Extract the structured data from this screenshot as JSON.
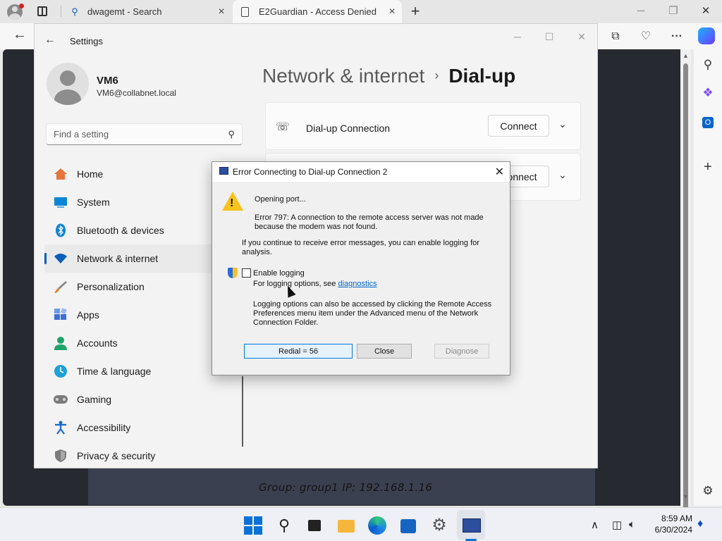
{
  "browser": {
    "tabs": [
      {
        "title": "dwagemt - Search",
        "icon": "search-icon"
      },
      {
        "title": "E2Guardian - Access Denied",
        "icon": "page-icon"
      }
    ],
    "new_tab_label": "+",
    "window_minimize": "─",
    "window_restore": "❐",
    "window_close": "✕",
    "back_label": "←",
    "toolbar_icons": [
      "collections-icon",
      "performance-icon",
      "more-icon",
      "copilot-icon"
    ],
    "more_label": "···",
    "sidebar_icons": [
      "search-icon",
      "copilot-icon",
      "outlook-icon",
      "add-icon",
      "settings-icon"
    ]
  },
  "remote": {
    "info": "Group: group1   IP: 192.168.1.16"
  },
  "settings": {
    "title": "Settings",
    "back_label": "←",
    "controls": {
      "minimize": "─",
      "maximize": "☐",
      "close": "✕"
    },
    "user": {
      "name": "VM6",
      "email": "VM6@collabnet.local"
    },
    "search_placeholder": "Find a setting",
    "nav": [
      {
        "label": "Home",
        "icon": "home-icon",
        "color": "#e8743b"
      },
      {
        "label": "System",
        "icon": "system-icon",
        "color": "#0a84d6"
      },
      {
        "label": "Bluetooth & devices",
        "icon": "bluetooth-icon",
        "color": "#0a84d6"
      },
      {
        "label": "Network & internet",
        "icon": "wifi-icon",
        "color": "#0a5fb8",
        "active": true
      },
      {
        "label": "Personalization",
        "icon": "brush-icon",
        "color": "#e0872b"
      },
      {
        "label": "Apps",
        "icon": "apps-icon",
        "color": "#3c6fd6"
      },
      {
        "label": "Accounts",
        "icon": "account-icon",
        "color": "#1fa36b"
      },
      {
        "label": "Time & language",
        "icon": "globe-icon",
        "color": "#1ea0d8"
      },
      {
        "label": "Gaming",
        "icon": "gamepad-icon",
        "color": "#6d6d6d"
      },
      {
        "label": "Accessibility",
        "icon": "accessibility-icon",
        "color": "#1a6ad0"
      },
      {
        "label": "Privacy & security",
        "icon": "shield-icon",
        "color": "#6d6d6d"
      }
    ],
    "breadcrumb": {
      "parent": "Network & internet",
      "separator": "›",
      "current": "Dial-up"
    },
    "cards": [
      {
        "title": "Dial-up Connection",
        "button": "Connect"
      },
      {
        "title": "",
        "button": "Connect"
      }
    ],
    "chevron": "⌄"
  },
  "dialog": {
    "title": "Error Connecting to Dial-up Connection 2",
    "close_label": "✕",
    "status": "Opening port...",
    "error_line1": "Error 797: A connection to the remote access server was not made",
    "error_line2": "because the modem was not found.",
    "info_line1": "If you continue to receive error messages, you can enable logging for",
    "info_line2": "analysis.",
    "checkbox_label": "Enable logging",
    "logging_prefix": "For logging options, see",
    "logging_link": "diagnostics",
    "options_line1": "Logging options can also be accessed by clicking the Remote Access",
    "options_line2": "Preferences menu item under the Advanced menu of the Network",
    "options_line3": "Connection Folder.",
    "buttons": {
      "redial": "Redial = 56",
      "close": "Close",
      "diagnose": "Diagnose"
    }
  },
  "taskbar": {
    "apps": [
      "start-icon",
      "search-icon",
      "task-view-icon",
      "file-explorer-icon",
      "edge-icon",
      "store-icon",
      "settings-icon",
      "remote-desktop-icon"
    ],
    "tray": {
      "chevron": "∧",
      "time": "8:59 AM",
      "date": "6/30/2024"
    }
  }
}
